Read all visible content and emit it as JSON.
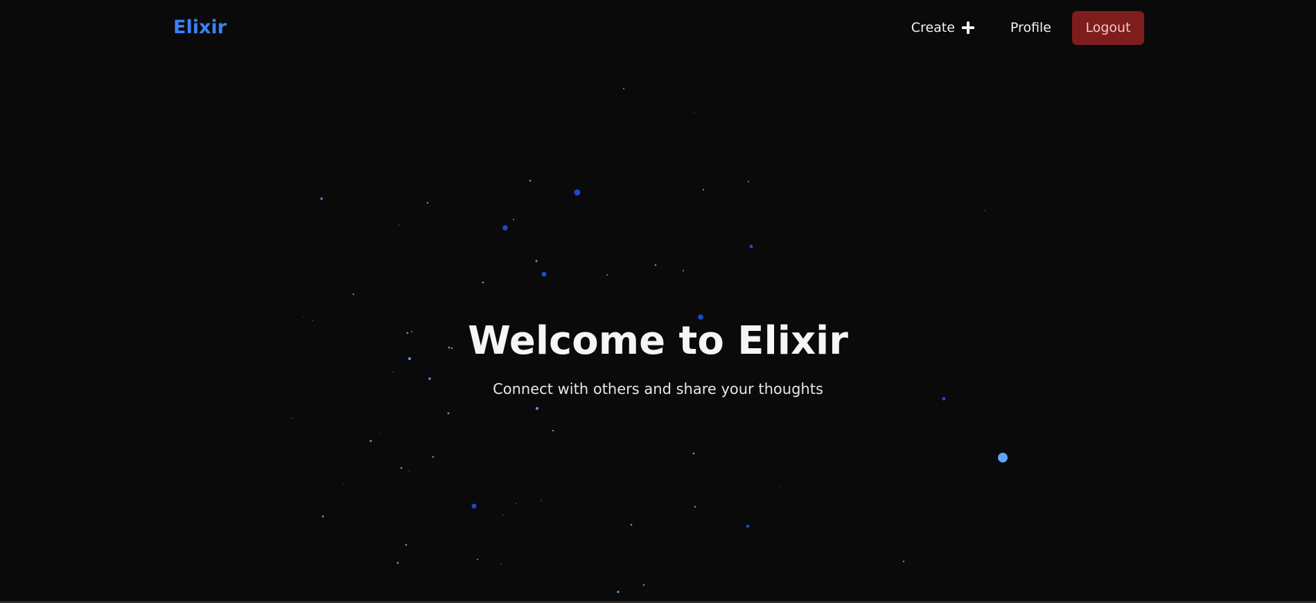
{
  "colors": {
    "background": "#0a0a0b",
    "brand": "#3b82f6",
    "logout_bg": "#7f1d1d",
    "particle_dark": "#1d4ed8",
    "particle_light": "#60a5fa"
  },
  "navbar": {
    "brand": "Elixir",
    "create_label": "Create",
    "create_icon": "plus-icon",
    "profile_label": "Profile",
    "logout_label": "Logout"
  },
  "hero": {
    "title": "Welcome to Elixir",
    "subtitle": "Connect with others and share your thoughts"
  }
}
